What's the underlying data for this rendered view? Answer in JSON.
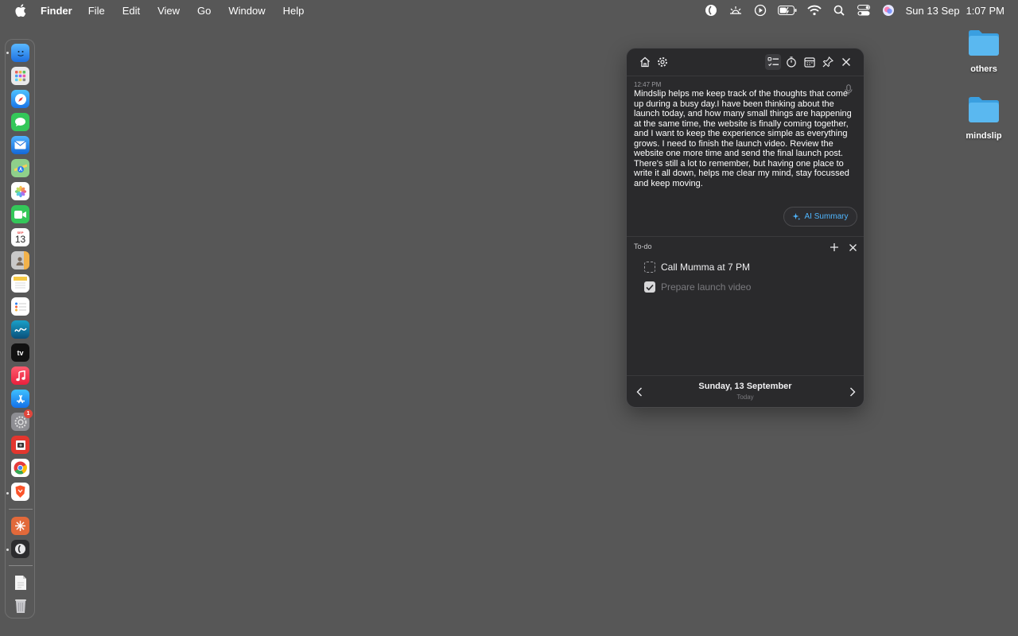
{
  "menubar": {
    "app_name": "Finder",
    "items": [
      "File",
      "Edit",
      "View",
      "Go",
      "Window",
      "Help"
    ],
    "date": "Sun 13 Sep",
    "time": "1:07 PM"
  },
  "desktop": {
    "folders": [
      {
        "label": "others"
      },
      {
        "label": "mindslip"
      }
    ]
  },
  "dock": {
    "calendar_day": "13",
    "calendar_month": "SEP",
    "tv_label": "tv",
    "settings_badge": "1"
  },
  "panel": {
    "note": {
      "time": "12:47 PM",
      "text": "Mindslip helps me keep track of the thoughts that come up during a busy day.I have been thinking about the launch today, and how many small things are happening at the same time, the website is finally coming together, and I want to keep the experience simple as everything grows. I need to finish the launch video. Review the website one more time and send the final launch post. There's still a lot to remember, but having one place to write it all down, helps me clear my mind, stay focussed and keep moving."
    },
    "ai_summary_label": "AI Summary",
    "todo": {
      "title": "To-do",
      "items": [
        {
          "label": "Call Mumma at 7 PM",
          "done": false
        },
        {
          "label": "Prepare launch video",
          "done": true
        }
      ]
    },
    "date_nav": {
      "date": "Sunday, 13 September",
      "sub": "Today"
    }
  },
  "colors": {
    "desktop_bg": "#575757",
    "panel_bg": "#2a2a2c",
    "accent": "#4fb6ff"
  }
}
